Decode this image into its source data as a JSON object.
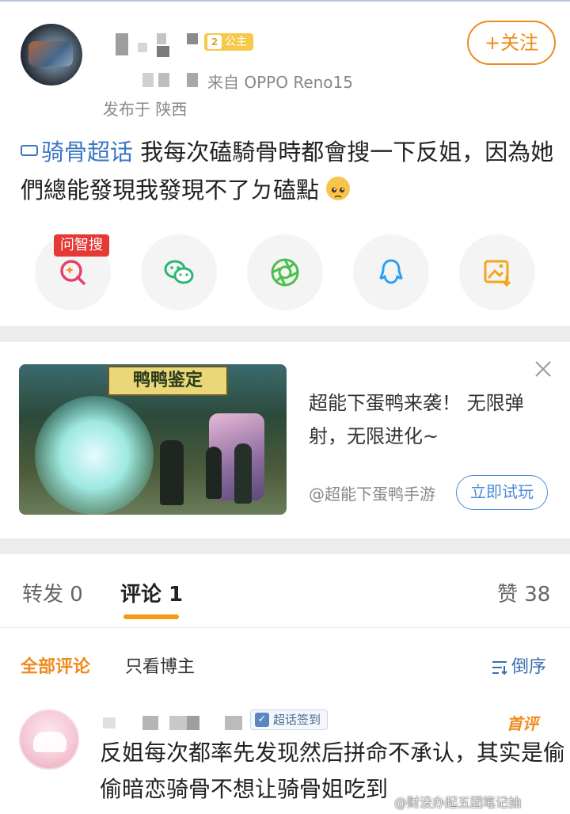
{
  "post": {
    "badge_level": "2",
    "badge_title": "公主",
    "source": "来自 OPPO Reno15",
    "location": "发布于 陕西",
    "follow_label": "+关注",
    "topic": "骑骨超话",
    "text": "我每次磕騎骨時都會搜一下反姐，因為她們總能發現我發現不了ㄉ磕點",
    "emoji": "pleading-face-emoji",
    "share": {
      "search_tag": "问智搜",
      "buttons": [
        "search-ai-icon",
        "wechat-icon",
        "moments-icon",
        "qq-icon",
        "save-image-icon"
      ]
    }
  },
  "ad": {
    "image_sign": "鸭鸭鉴定",
    "text": "超能下蛋鸭来袭！ 无限弹射，无限进化~",
    "source": "@超能下蛋鸭手游",
    "cta": "立即试玩"
  },
  "tabs": {
    "repost": "转发 0",
    "comment": "评论 1",
    "like": "赞 38"
  },
  "filters": {
    "all": "全部评论",
    "op_only": "只看博主",
    "sort": "倒序"
  },
  "comment": {
    "badge": "超话签到",
    "first_label": "首评",
    "text": "反姐每次都率先发现然后拼命不承认，其实是偷偷暗恋骑骨不想让骑骨姐吃到"
  },
  "watermark": "@财没办起五团笔记抽",
  "colors": {
    "accent": "#f08a1c",
    "link": "#3a78c3",
    "badge_yellow": "#f7c94a",
    "red_tag": "#e53935"
  }
}
